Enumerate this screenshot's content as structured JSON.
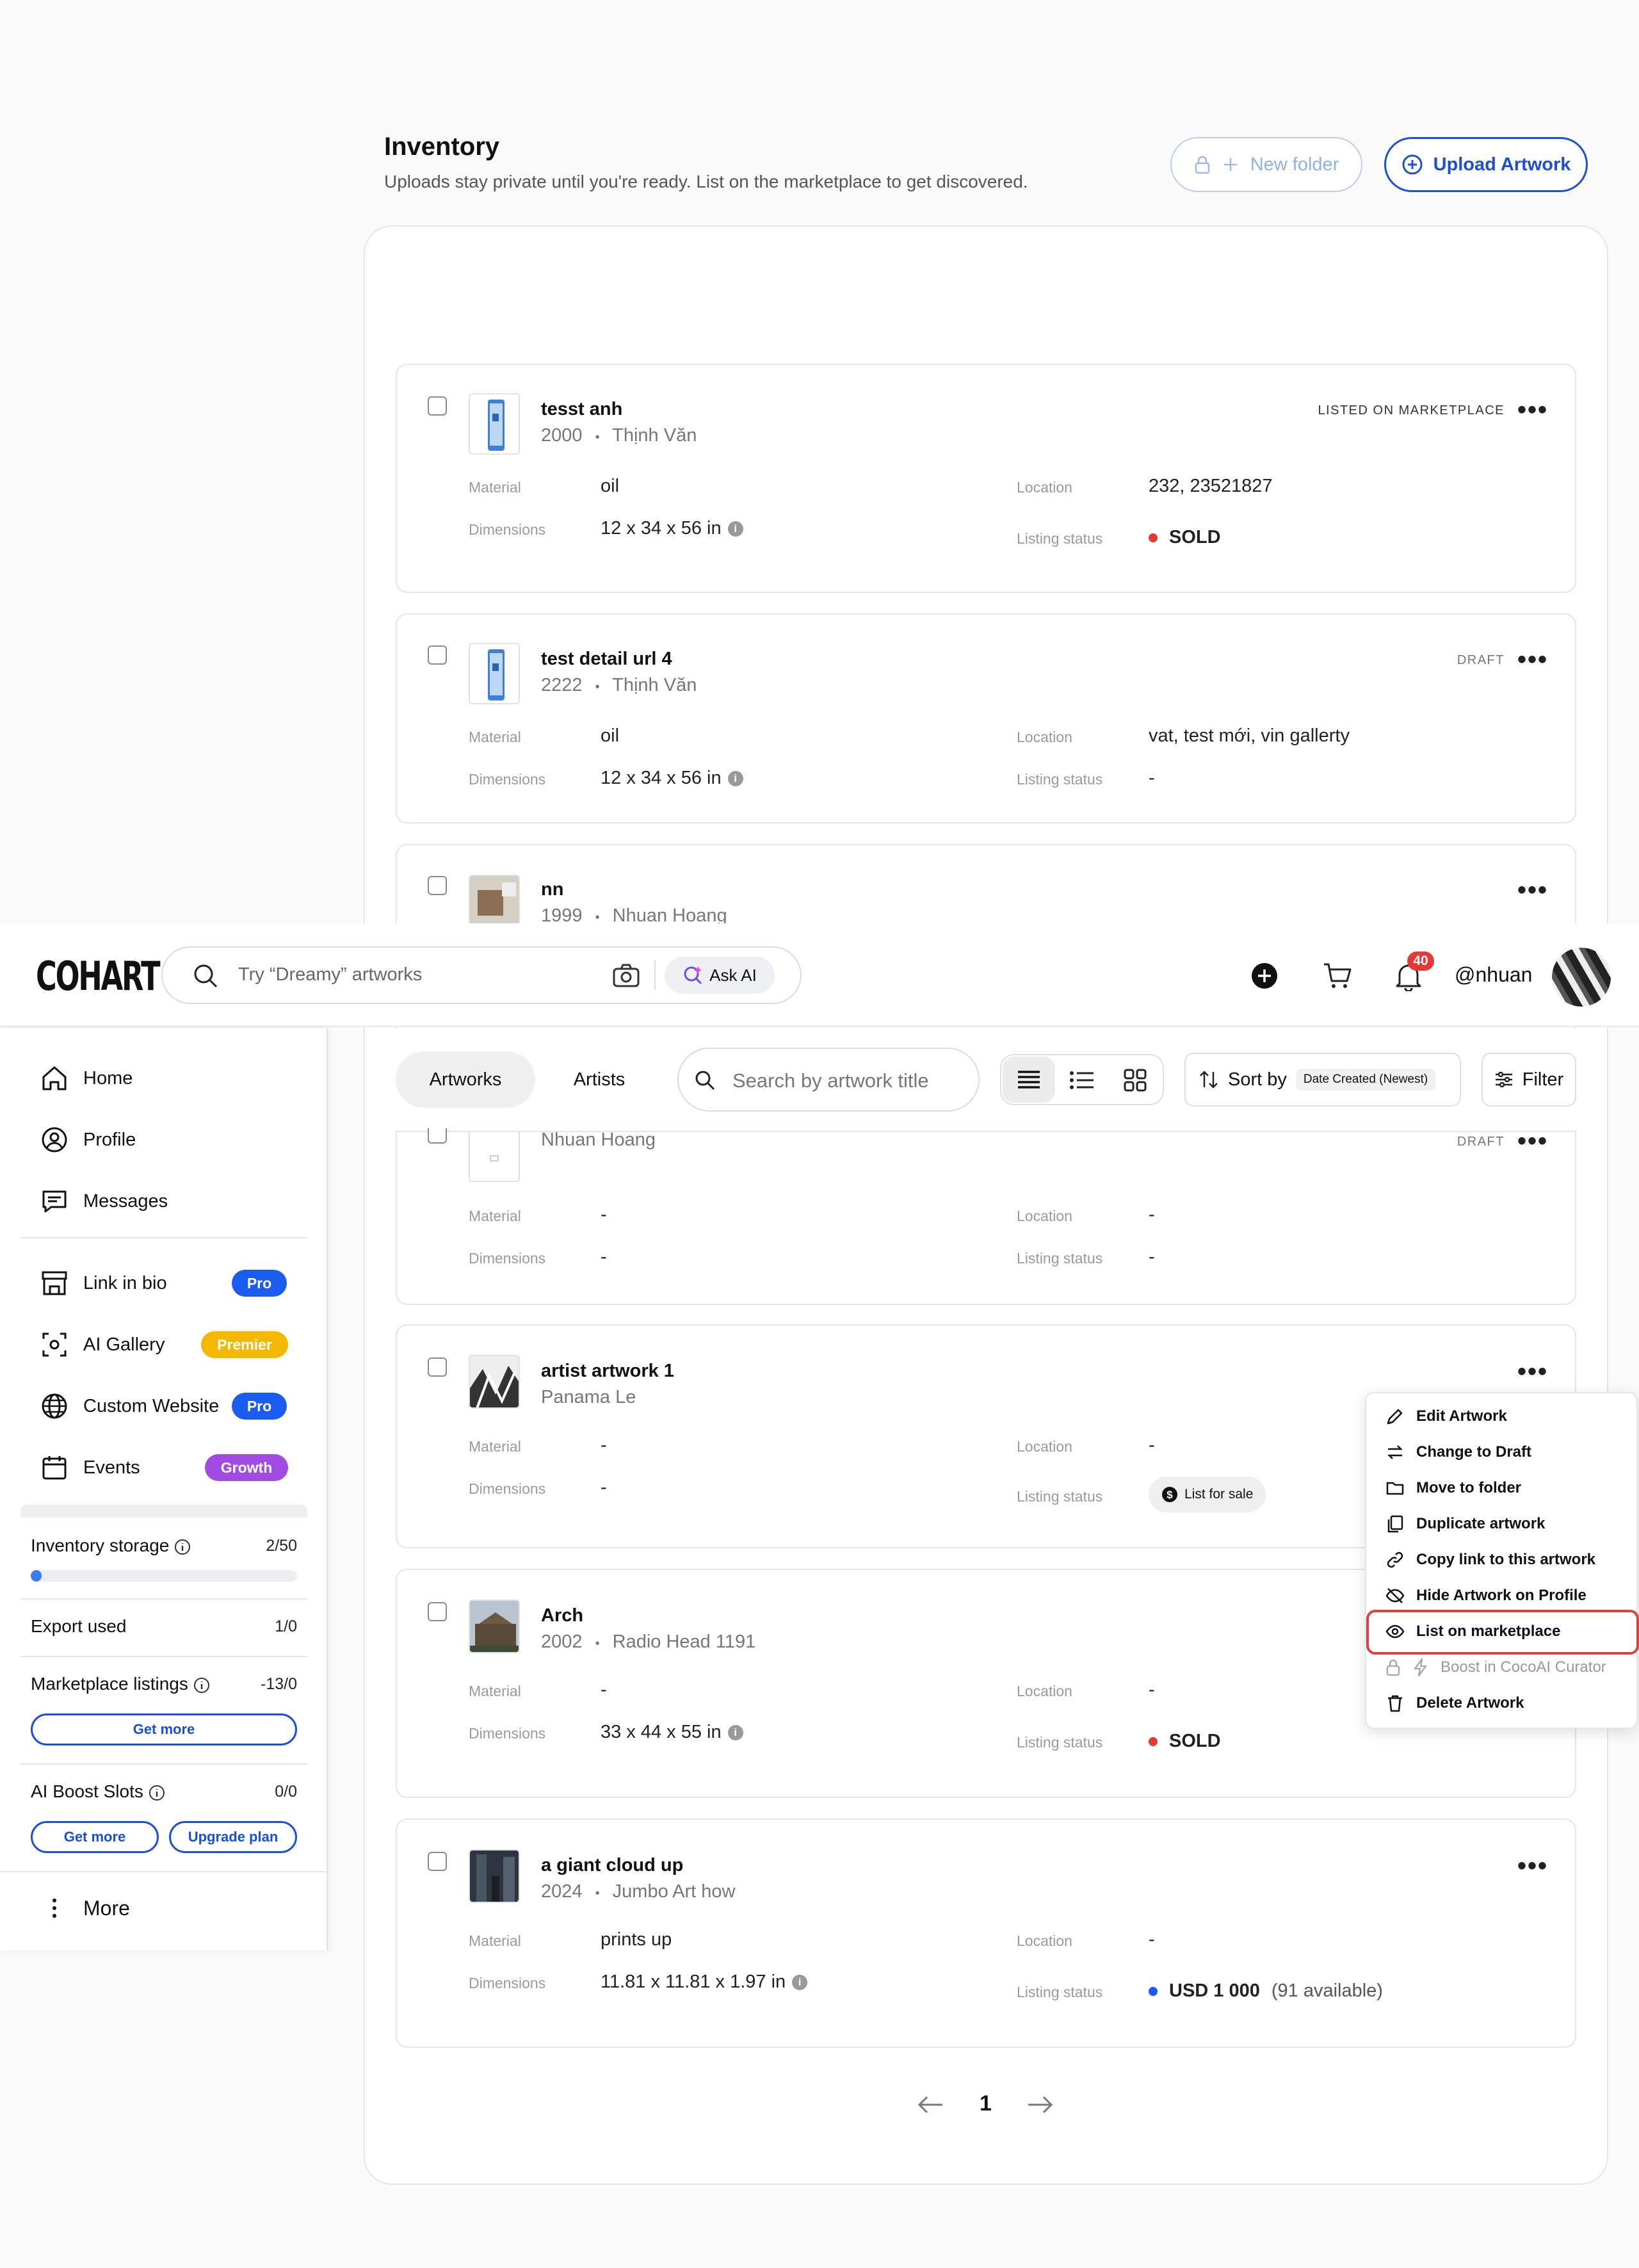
{
  "page": {
    "title": "Inventory",
    "subtitle": "Uploads stay private until you're ready. List on the marketplace to get discovered.",
    "new_folder_label": "New folder",
    "upload_label": "Upload Artwork"
  },
  "labels": {
    "material": "Material",
    "dimensions": "Dimensions",
    "location": "Location",
    "listing_status": "Listing status",
    "separator": "•"
  },
  "artworks": [
    {
      "title": "tesst anh",
      "year": "2000",
      "artist": "Thịnh Văn",
      "badge": "LISTED ON MARKETPLACE",
      "material": "oil",
      "dimensions": "12 x 34 x 56 in",
      "location": "232, 23521827",
      "status": "SOLD"
    },
    {
      "title": "test detail url 4",
      "year": "2222",
      "artist": "Thịnh Văn",
      "badge": "DRAFT",
      "material": "oil",
      "dimensions": "12 x 34 x 56 in",
      "location": "vat, test mới, vin gallerty",
      "status": "-"
    },
    {
      "title": "nn",
      "year": "1999",
      "artist": "Nhuan Hoang",
      "artist_cut": "Nhuan Hoang",
      "badge": "DRAFT",
      "material": "-",
      "dimensions": "-",
      "location": "-",
      "status": "-"
    },
    {
      "title": "artist artwork 1",
      "artist": "Panama Le",
      "material": "-",
      "dimensions": "-",
      "location": "-",
      "status": "List for sale"
    },
    {
      "title": "Arch",
      "year": "2002",
      "artist": "Radio Head 1191",
      "material": "-",
      "dimensions": "33 x 44 x 55 in",
      "location": "-",
      "status": "SOLD"
    },
    {
      "title": "a giant cloud up",
      "year": "2024",
      "artist": "Jumbo Art how",
      "material": "prints up",
      "dimensions": "11.81 x 11.81 x 1.97 in",
      "location": "-",
      "status": "USD 1 000",
      "status_note": "(91 available)"
    }
  ],
  "topbar": {
    "logo": "COHART",
    "search_placeholder": "Try “Dreamy” artworks",
    "ask_ai": "Ask AI",
    "notification_count": "40",
    "username": "@nhuan"
  },
  "sidebar": {
    "nav": [
      {
        "label": "Home",
        "icon": "home-icon"
      },
      {
        "label": "Profile",
        "icon": "profile-icon"
      },
      {
        "label": "Messages",
        "icon": "messages-icon"
      }
    ],
    "features": [
      {
        "label": "Link in bio",
        "pill": "Pro",
        "pill_color": "#1a5cf0",
        "icon": "store-icon"
      },
      {
        "label": "AI Gallery",
        "pill": "Premier",
        "pill_color": "#f5b800",
        "icon": "ai-gallery-icon"
      },
      {
        "label": "Custom Website",
        "pill": "Pro",
        "pill_color": "#1a5cf0",
        "icon": "globe-icon"
      },
      {
        "label": "Events",
        "pill": "Growth",
        "pill_color": "#a24be3",
        "icon": "calendar-icon"
      }
    ],
    "inventory_storage": {
      "label": "Inventory storage",
      "value": "2/50",
      "progress": 0.04
    },
    "export_used": {
      "label": "Export used",
      "value": "1/0"
    },
    "marketplace_listings": {
      "label": "Marketplace listings",
      "value": "-13/0",
      "button": "Get more"
    },
    "ai_boost": {
      "label": "AI Boost Slots",
      "value": "0/0",
      "button_get": "Get more",
      "button_upgrade": "Upgrade plan"
    },
    "more_label": "More"
  },
  "toolbar": {
    "tab_artworks": "Artworks",
    "tab_artists": "Artists",
    "search_placeholder": "Search by artwork title",
    "sort_label": "Sort by",
    "sort_value": "Date Created (Newest)",
    "filter_label": "Filter"
  },
  "menu": {
    "items": [
      {
        "label": "Edit Artwork",
        "icon": "pencil-icon"
      },
      {
        "label": "Change to Draft",
        "icon": "swap-icon"
      },
      {
        "label": "Move to folder",
        "icon": "folder-icon"
      },
      {
        "label": "Duplicate artwork",
        "icon": "duplicate-icon"
      },
      {
        "label": "Copy link to this artwork",
        "icon": "link-icon"
      },
      {
        "label": "Hide Artwork on Profile",
        "icon": "eye-off-icon"
      },
      {
        "label": "List on marketplace",
        "icon": "eye-icon"
      },
      {
        "label": "Boost in CocoAI Curator",
        "icon": "bolt-icon",
        "disabled": true
      },
      {
        "label": "Delete Artwork",
        "icon": "trash-icon"
      }
    ]
  },
  "pagination": {
    "current": "1"
  },
  "colors": {
    "accent": "#1a4fd6",
    "sold_dot": "#e53935",
    "price_dot": "#1a5cf0",
    "highlight": "#e04040"
  }
}
